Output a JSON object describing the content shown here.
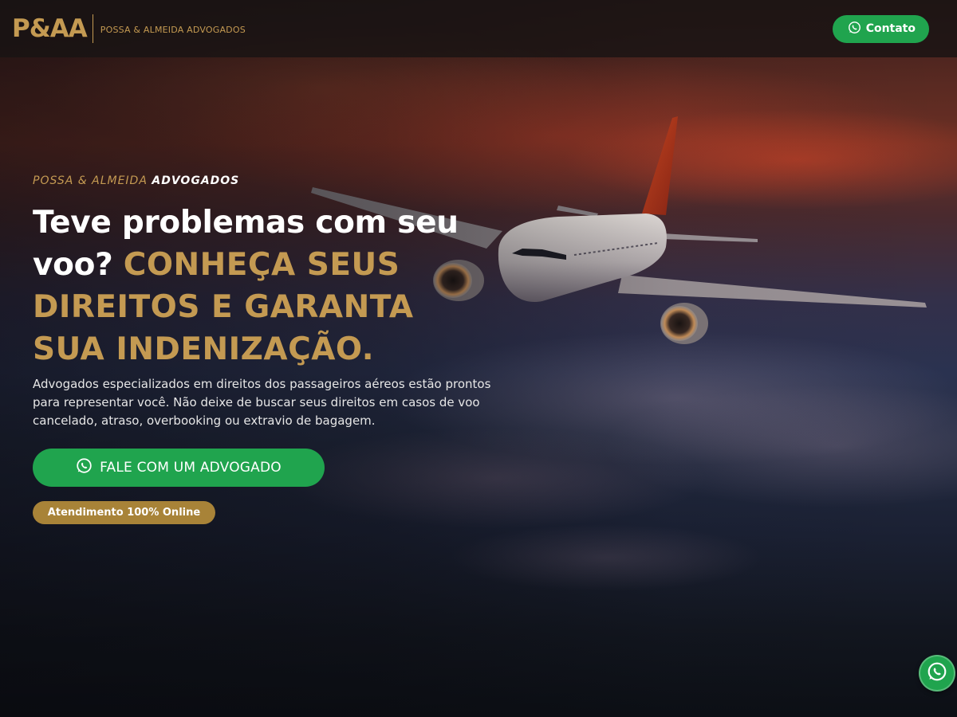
{
  "header": {
    "logo_mark": "P&AA",
    "logo_text": "POSSA & ALMEIDA ADVOGADOS",
    "contact_label": "Contato",
    "contact_icon": "whatsapp-icon"
  },
  "hero": {
    "eyebrow_light": "POSSA & ALMEIDA",
    "eyebrow_strong": "ADVOGADOS",
    "headline_white": "Teve problemas com seu voo?",
    "headline_gold": "CONHEÇA SEUS DIREITOS E GARANTA SUA INDENIZAÇÃO.",
    "description": "Advogados especializados em direitos dos passageiros aéreos estão prontos para representar você. Não deixe de buscar seus direitos em casos de voo cancelado, atraso, overbooking ou extravio de bagagem.",
    "cta_label": "FALE COM UM ADVOGADO",
    "cta_icon": "whatsapp-icon",
    "badge": "Atendimento 100% Online",
    "background_image": "airplane-flying-above-clouds-at-sunset"
  },
  "floating_button": {
    "icon": "whatsapp-icon"
  },
  "colors": {
    "gold": "#c49a52",
    "badge_gold": "#a88338",
    "whatsapp_green": "#20a44e",
    "header_bg": "#181414"
  }
}
